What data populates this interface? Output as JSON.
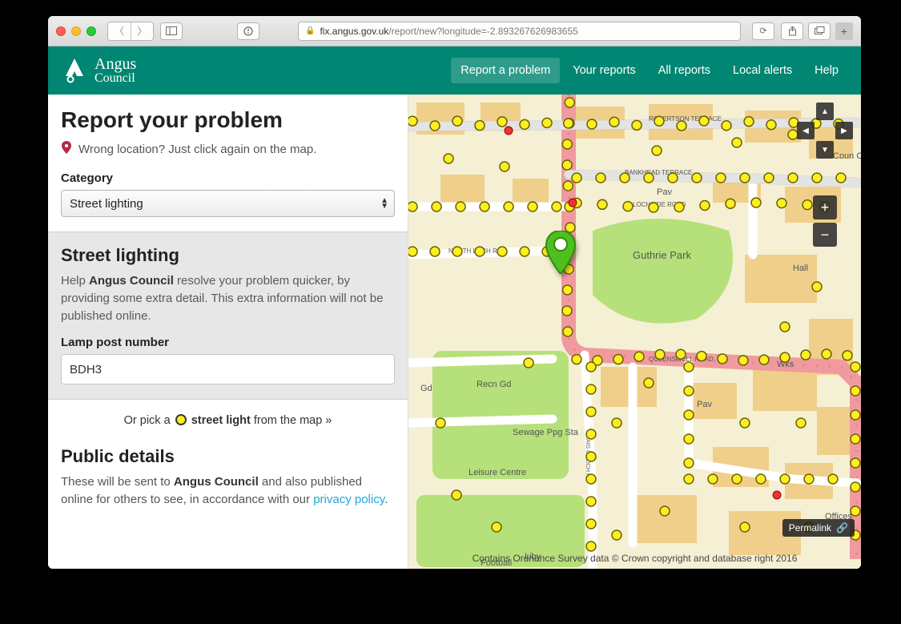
{
  "browser": {
    "url_host": "fix.angus.gov.uk",
    "url_path": "/report/new?longitude=-2.893267626983655"
  },
  "brand": {
    "line1": "Angus",
    "line2": "Council"
  },
  "nav": {
    "items": [
      {
        "label": "Report a problem",
        "active": true
      },
      {
        "label": "Your reports",
        "active": false
      },
      {
        "label": "All reports",
        "active": false
      },
      {
        "label": "Local alerts",
        "active": false
      },
      {
        "label": "Help",
        "active": false
      }
    ]
  },
  "form": {
    "heading": "Report your problem",
    "hint": "Wrong location? Just click again on the map.",
    "category_label": "Category",
    "category_value": "Street lighting",
    "sub_heading": "Street lighting",
    "sub_desc_pre": "Help ",
    "sub_desc_bold": "Angus Council",
    "sub_desc_post": " resolve your problem quicker, by providing some extra detail. This extra information will not be published online.",
    "lamp_label": "Lamp post number",
    "lamp_value": "BDH3",
    "pick_pre": "Or pick a ",
    "pick_bold": "street light",
    "pick_post": " from the map »",
    "public_heading": "Public details",
    "public_pre": "These will be sent to ",
    "public_bold": "Angus Council",
    "public_mid": " and also published online for others to see, in accordance with our ",
    "public_link": "privacy policy",
    "public_end": "."
  },
  "map": {
    "permalink": "Permalink",
    "attribution": "Contains Ordnance Survey data © Crown copyright and database right 2016",
    "labels": {
      "guthrie": "Guthrie Park",
      "pav1": "Pav",
      "pav2": "Pav",
      "hall": "Hall",
      "wks": "Wks",
      "recn": "Recn Gd",
      "sewage": "Sewage Ppg Sta",
      "leisure": "Leisure Centre",
      "liby": "Liby",
      "coun": "Coun Offs",
      "gd": "Gd",
      "football": "Football",
      "offices": "Offices",
      "bankhead": "BANKHEAD TERRACE",
      "lochside": "LOCHSIDE ROAD",
      "queenswell": "QUEENSWELL ROAD",
      "northloch": "NORTH LOCH RD",
      "robertson": "ROBERTSON TERRACE",
      "craig": "CRAIG O LOCH RD"
    }
  }
}
